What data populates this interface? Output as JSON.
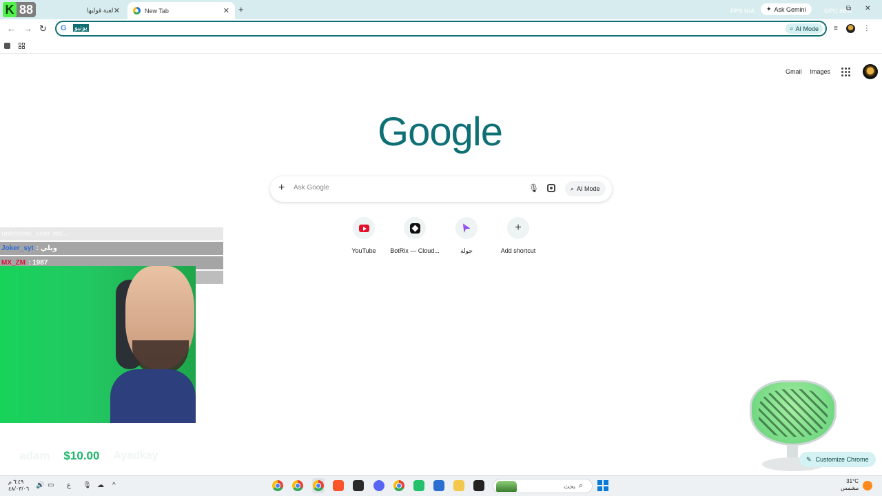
{
  "overlay": {
    "k_logo_number": "88",
    "top_right_stats": [
      "FPS N/A",
      "FPS N/A",
      "GPU 46%",
      "N/A"
    ],
    "tip": {
      "name": "adam",
      "amount": "$10.00",
      "extra": "Ayadkay"
    },
    "chat": [
      {
        "user": "unknown_user",
        "message": "wa..."
      },
      {
        "user": "Joker_syt",
        "message": ": ويلي"
      },
      {
        "user": "MX_ZM",
        "message": ": 1987"
      },
      {
        "user": "",
        "message": ""
      }
    ]
  },
  "browser": {
    "tabs": [
      {
        "title": "لعبة قوليها",
        "active": false
      },
      {
        "title": "New Tab",
        "active": true
      }
    ],
    "ask_gemini_label": "Ask Gemini",
    "address_bar": {
      "value": "يونيو",
      "ai_mode_label": "AI Mode"
    }
  },
  "ntp": {
    "top_links": {
      "gmail": "Gmail",
      "images": "Images"
    },
    "logo_text": "Google",
    "search": {
      "placeholder": "Ask Google",
      "ai_mode_label": "AI Mode"
    },
    "shortcuts": [
      {
        "label": "YouTube",
        "icon": "youtube-icon"
      },
      {
        "label": "BotRix — Cloud...",
        "icon": "botrix-icon"
      },
      {
        "label": "جولة",
        "icon": "cursor-icon"
      },
      {
        "label": "Add shortcut",
        "icon": "plus-icon"
      }
    ],
    "customize_label": "Customize Chrome"
  },
  "taskbar": {
    "clock_time": "٦:٤٩ م",
    "clock_date": "٤٨/٠٣/٠٦",
    "search_placeholder": "بحث",
    "weather_temp": "31°C",
    "weather_desc": "مشمس",
    "language": "ع"
  },
  "colors": {
    "accent": "#0e7075",
    "tabstrip": "#d7ecee",
    "tip_amount": "#1fb56a",
    "k_logo_green": "#52f04a"
  }
}
